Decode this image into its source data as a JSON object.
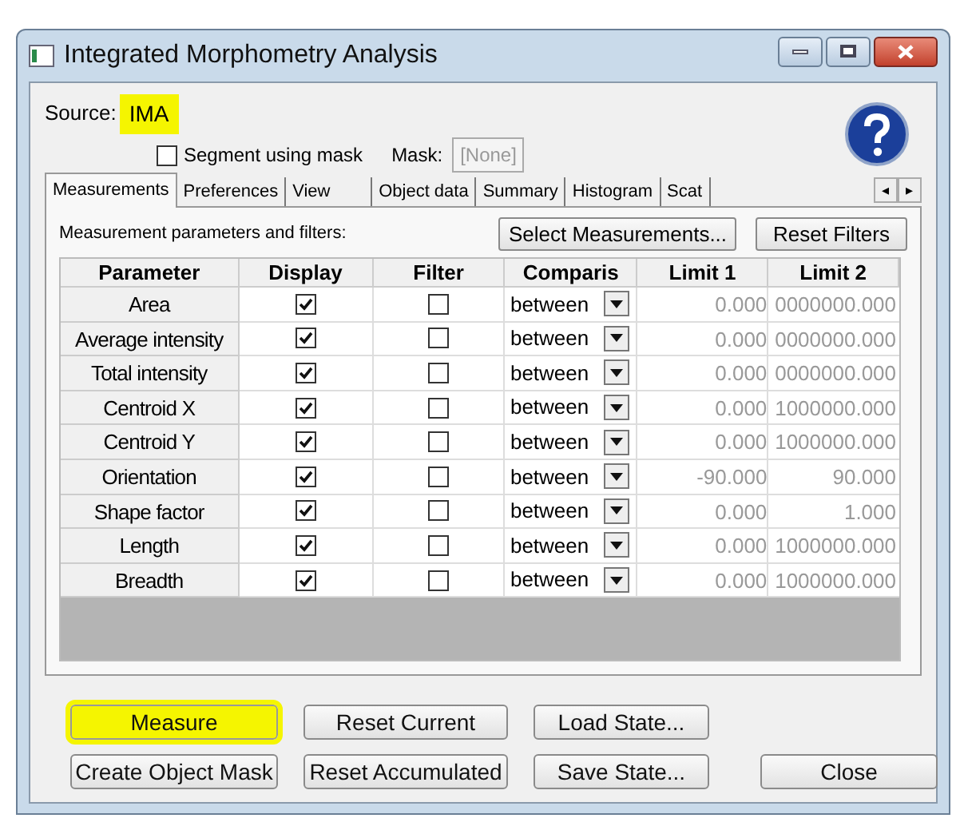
{
  "window": {
    "title": "Integrated Morphometry Analysis"
  },
  "source": {
    "label": "Source:",
    "value": "IMA",
    "highlighted": true
  },
  "segment_checkbox": {
    "label": "Segment using mask",
    "checked": false
  },
  "mask": {
    "label": "Mask:",
    "value": "[None]",
    "disabled": true
  },
  "tabs": [
    {
      "label": "Measurements",
      "selected": true
    },
    {
      "label": "Preferences",
      "selected": false
    },
    {
      "label": "View",
      "selected": false
    },
    {
      "label": "Object data",
      "selected": false
    },
    {
      "label": "Summary",
      "selected": false
    },
    {
      "label": "Histogram",
      "selected": false
    },
    {
      "label": "Scat",
      "selected": false
    }
  ],
  "tab_scroll": [
    "◂",
    "▸"
  ],
  "measurements": {
    "caption": "Measurement parameters and filters:",
    "buttons": [
      "Select Measurements...",
      "Reset Filters"
    ],
    "columns": [
      "Parameter",
      "Display",
      "Filter",
      "Comparis",
      "Limit 1",
      "Limit 2"
    ],
    "rows": [
      {
        "parameter": "Area",
        "display": true,
        "filter": false,
        "comparison": "between",
        "limit1": "0.000",
        "limit2": "0000000.000"
      },
      {
        "parameter": "Average intensity",
        "display": true,
        "filter": false,
        "comparison": "between",
        "limit1": "0.000",
        "limit2": "0000000.000"
      },
      {
        "parameter": "Total intensity",
        "display": true,
        "filter": false,
        "comparison": "between",
        "limit1": "0.000",
        "limit2": "0000000.000"
      },
      {
        "parameter": "Centroid X",
        "display": true,
        "filter": false,
        "comparison": "between",
        "limit1": "0.000",
        "limit2": "1000000.000"
      },
      {
        "parameter": "Centroid Y",
        "display": true,
        "filter": false,
        "comparison": "between",
        "limit1": "0.000",
        "limit2": "1000000.000"
      },
      {
        "parameter": "Orientation",
        "display": true,
        "filter": false,
        "comparison": "between",
        "limit1": "-90.000",
        "limit2": "90.000"
      },
      {
        "parameter": "Shape factor",
        "display": true,
        "filter": false,
        "comparison": "between",
        "limit1": "0.000",
        "limit2": "1.000"
      },
      {
        "parameter": "Length",
        "display": true,
        "filter": false,
        "comparison": "between",
        "limit1": "0.000",
        "limit2": "1000000.000"
      },
      {
        "parameter": "Breadth",
        "display": true,
        "filter": false,
        "comparison": "between",
        "limit1": "0.000",
        "limit2": "1000000.000"
      }
    ]
  },
  "buttons": [
    {
      "label": "Measure",
      "highlighted": true
    },
    {
      "label": "Reset Current",
      "highlighted": false
    },
    {
      "label": "Load State...",
      "highlighted": false
    },
    {
      "label": "Create Object Mask",
      "highlighted": false
    },
    {
      "label": "Reset Accumulated",
      "highlighted": false
    },
    {
      "label": "Save State...",
      "highlighted": false
    },
    {
      "label": "Close",
      "highlighted": false
    }
  ]
}
